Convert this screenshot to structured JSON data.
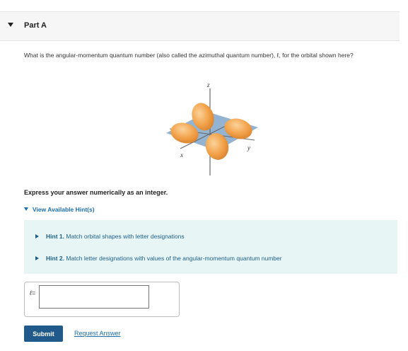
{
  "part": {
    "title": "Part A"
  },
  "question": {
    "text": "What is the angular-momentum quantum number (also called the azimuthal quantum number), ℓ, for the orbital shown here?"
  },
  "figure": {
    "axis_z": "z",
    "axis_x": "x",
    "axis_y": "y",
    "plane_color": "#7fa6c9",
    "lobe_color": "#f2a24a"
  },
  "instruction": "Express your answer numerically as an integer.",
  "hints": {
    "toggle_label": "View Available Hint(s)",
    "items": [
      {
        "number": "Hint 1.",
        "text": "Match orbital shapes with letter designations"
      },
      {
        "number": "Hint 2.",
        "text": "Match letter designations with values of the angular-momentum quantum number"
      }
    ]
  },
  "answer": {
    "label": "ℓ=",
    "value": ""
  },
  "actions": {
    "submit_label": "Submit",
    "request_label": "Request Answer"
  }
}
